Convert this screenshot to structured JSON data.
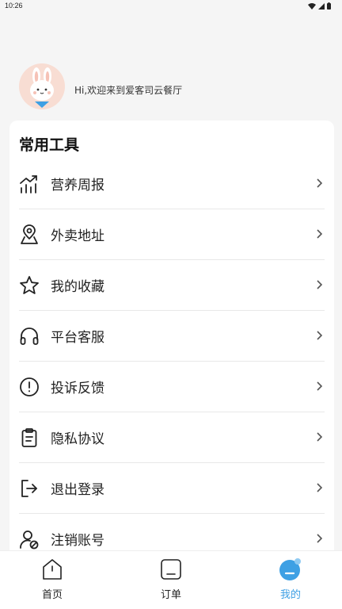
{
  "status_bar": {
    "time": "10:26"
  },
  "profile": {
    "greeting": "Hi,欢迎来到爱客司云餐厅"
  },
  "tools": {
    "title": "常用工具",
    "items": [
      {
        "label": "营养周报",
        "icon": "chart-trend-icon"
      },
      {
        "label": "外卖地址",
        "icon": "location-pin-icon"
      },
      {
        "label": "我的收藏",
        "icon": "star-icon"
      },
      {
        "label": "平台客服",
        "icon": "headphones-icon"
      },
      {
        "label": "投诉反馈",
        "icon": "alert-circle-icon"
      },
      {
        "label": "隐私协议",
        "icon": "clipboard-icon"
      },
      {
        "label": "退出登录",
        "icon": "logout-icon"
      },
      {
        "label": "注销账号",
        "icon": "user-remove-icon"
      }
    ]
  },
  "tabbar": {
    "tabs": [
      {
        "label": "首页",
        "icon": "home-icon"
      },
      {
        "label": "订单",
        "icon": "order-icon"
      },
      {
        "label": "我的",
        "icon": "profile-icon",
        "active": true
      }
    ],
    "active_color": "#3ea0e4"
  }
}
